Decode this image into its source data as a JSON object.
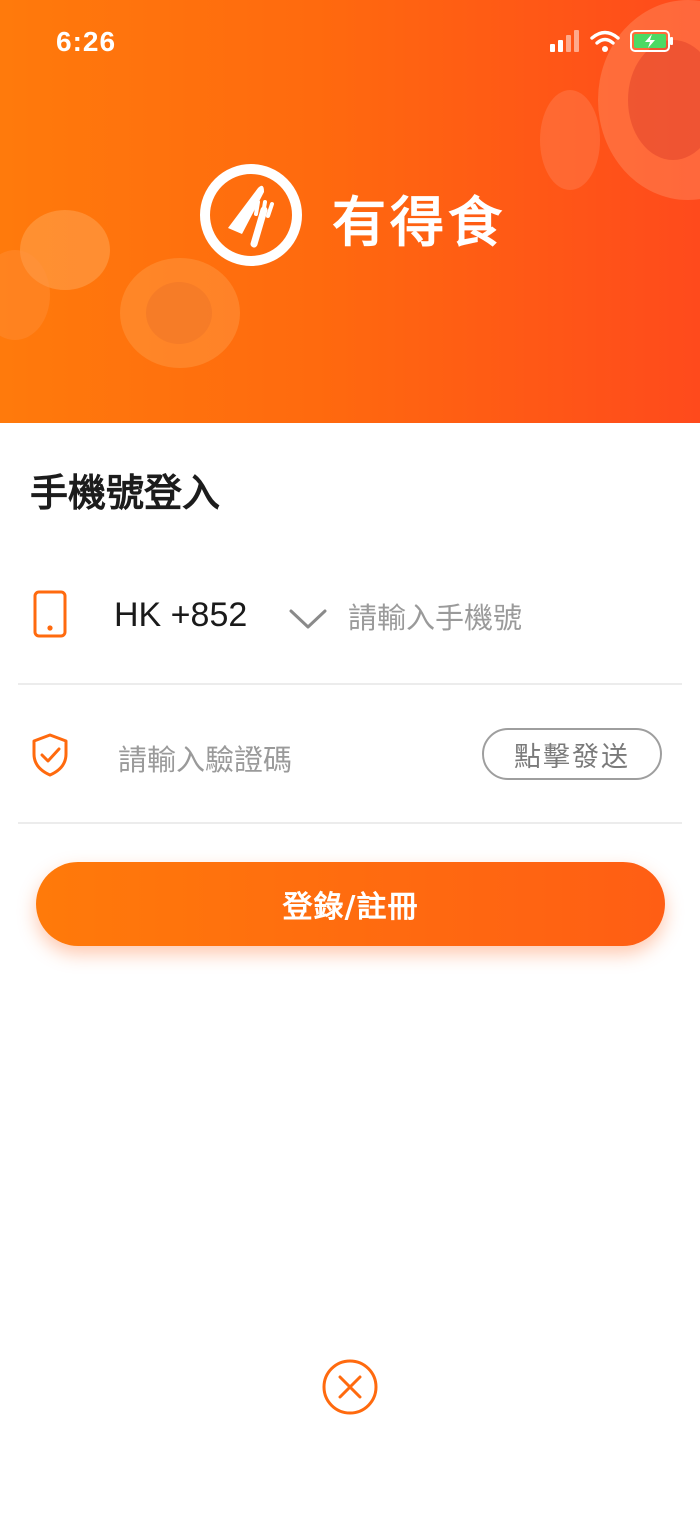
{
  "status_bar": {
    "time": "6:26"
  },
  "brand": {
    "name": "有得食",
    "logo_icon": "plate-fork-knife-icon"
  },
  "login": {
    "title": "手機號登入",
    "country_code": "HK +852",
    "phone_placeholder": "請輸入手機號",
    "code_placeholder": "請輸入驗證碼",
    "send_code_label": "點擊發送",
    "submit_label": "登錄/註冊"
  },
  "colors": {
    "accent": "#ff6a0e",
    "accent_end": "#ff4a1c",
    "divider": "#ececec",
    "placeholder": "#9a9a9a"
  }
}
